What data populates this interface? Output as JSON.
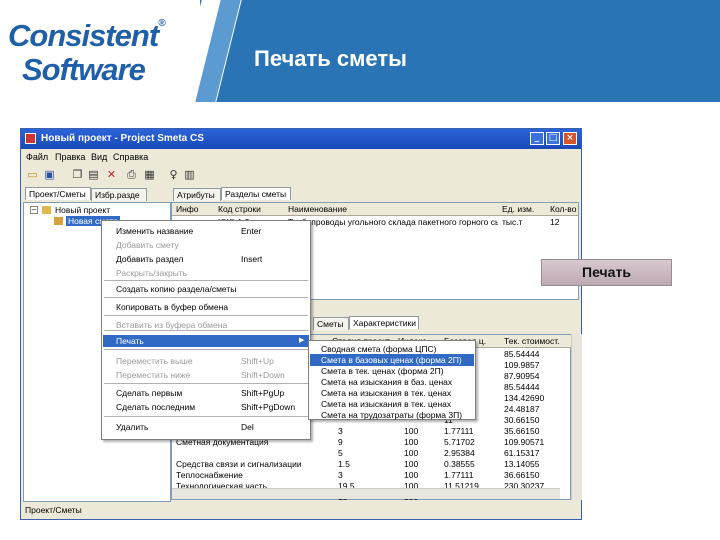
{
  "slide": {
    "logo_line1": "Consistent",
    "logo_mark": "®",
    "logo_line2": "Software",
    "title": "Печать сметы",
    "callout": "Печать"
  },
  "window": {
    "title": "Новый проект - Project Smeta CS",
    "controls": [
      "_",
      "□",
      "×"
    ],
    "menu": [
      "Файл",
      "Правка",
      "Вид",
      "Справка"
    ],
    "toolbar_icons": [
      "open-folder-icon",
      "save-icon",
      "copy-icon",
      "paste-icon",
      "delete-icon",
      "print-icon",
      "print-preview-icon",
      "pin-icon",
      "calculator-icon"
    ],
    "left_tabs": [
      "Проект/Сметы",
      "Избр.разде"
    ],
    "right_tabs": [
      "Атрибуты",
      "Разделы сметы"
    ],
    "tree": [
      {
        "label": "Новый проект"
      },
      {
        "label": "Новая смета"
      }
    ],
    "grid1": {
      "headers": [
        "Инфо",
        "Код строки",
        "Наименование",
        "Ед. изм.",
        "Кол-во"
      ],
      "rows": [
        [
          "",
          "ЮЮ.1.2",
          "Трубопроводы угольного склада пакетного горного сырья",
          "тыс.т",
          "12"
        ]
      ]
    },
    "lower_tabs": [
      "Сметы",
      "Характеристики"
    ],
    "grid2": {
      "headers": [
        "",
        "Стадия проект.",
        "Индекс",
        "Базовая ц.",
        "Тек. стоимост."
      ],
      "rows": [
        [
          "",
          "",
          "",
          "",
          "85.54444"
        ],
        [
          "",
          "",
          "",
          ".32",
          "109.9857"
        ],
        [
          "",
          "",
          "",
          "",
          "87.90954"
        ],
        [
          "",
          "",
          "",
          "55",
          "85.54444"
        ],
        [
          "",
          "",
          "",
          "00",
          "134.42690"
        ],
        [
          "",
          "",
          "",
          "74",
          "24.48187"
        ],
        [
          "",
          "",
          "",
          "11",
          "30.66150"
        ],
        [
          "",
          "3",
          "100",
          "1.77111",
          "35.66150"
        ],
        [
          "Сметная документация",
          "9",
          "100",
          "5.71702",
          "109.90571"
        ],
        [
          "",
          "5",
          "100",
          "2.95384",
          "61.15317"
        ],
        [
          "Средства связи и сигнализации",
          "1.5",
          "100",
          "0.38555",
          "13.14055"
        ],
        [
          "Теплоснабжение",
          "3",
          "100",
          "1.77111",
          "36.66150"
        ],
        [
          "Технологическая часть",
          "19.5",
          "100",
          "11.51219",
          "230.30237"
        ],
        [
          "",
          "15",
          "100",
          "",
          ""
        ]
      ]
    },
    "status_text": "Проект/Сметы"
  },
  "context_menu": {
    "items": [
      {
        "label": "Изменить название",
        "shortcut": "Enter",
        "disabled": false
      },
      {
        "label": "Добавить смету",
        "shortcut": "",
        "disabled": true
      },
      {
        "label": "Добавить раздел",
        "shortcut": "Insert",
        "disabled": false
      },
      {
        "label": "Раскрыть/закрыть",
        "shortcut": "",
        "disabled": true
      },
      {
        "label": "Создать копию раздела/сметы",
        "shortcut": "",
        "disabled": false
      },
      {
        "label": "Копировать в буфер обмена",
        "shortcut": "",
        "disabled": false
      },
      {
        "label": "Вставить из буфера обмена",
        "shortcut": "",
        "disabled": true
      },
      {
        "label": "Печать",
        "shortcut": "",
        "disabled": false
      },
      {
        "label": "Переместить выше",
        "shortcut": "Shift+Up",
        "disabled": true
      },
      {
        "label": "Переместить ниже",
        "shortcut": "Shift+Down",
        "disabled": true
      },
      {
        "label": "Сделать первым",
        "shortcut": "Shift+PgUp",
        "disabled": false
      },
      {
        "label": "Сделать последним",
        "shortcut": "Shift+PgDown",
        "disabled": false
      },
      {
        "label": "Удалить",
        "shortcut": "Del",
        "disabled": false
      }
    ],
    "arrow": "▶"
  },
  "submenu": {
    "items": [
      "Сводная смета (форма ЦПС)",
      "Смета в базовых ценах (форма 2П)",
      "Смета в тек. ценах (форма 2П)",
      "Смета на изыскания в баз. ценах",
      "Смета на изыскания в тек. ценах",
      "Смета на изыскания в тек. ценах",
      "Смета на трудозатраты (форма 3П)"
    ]
  }
}
